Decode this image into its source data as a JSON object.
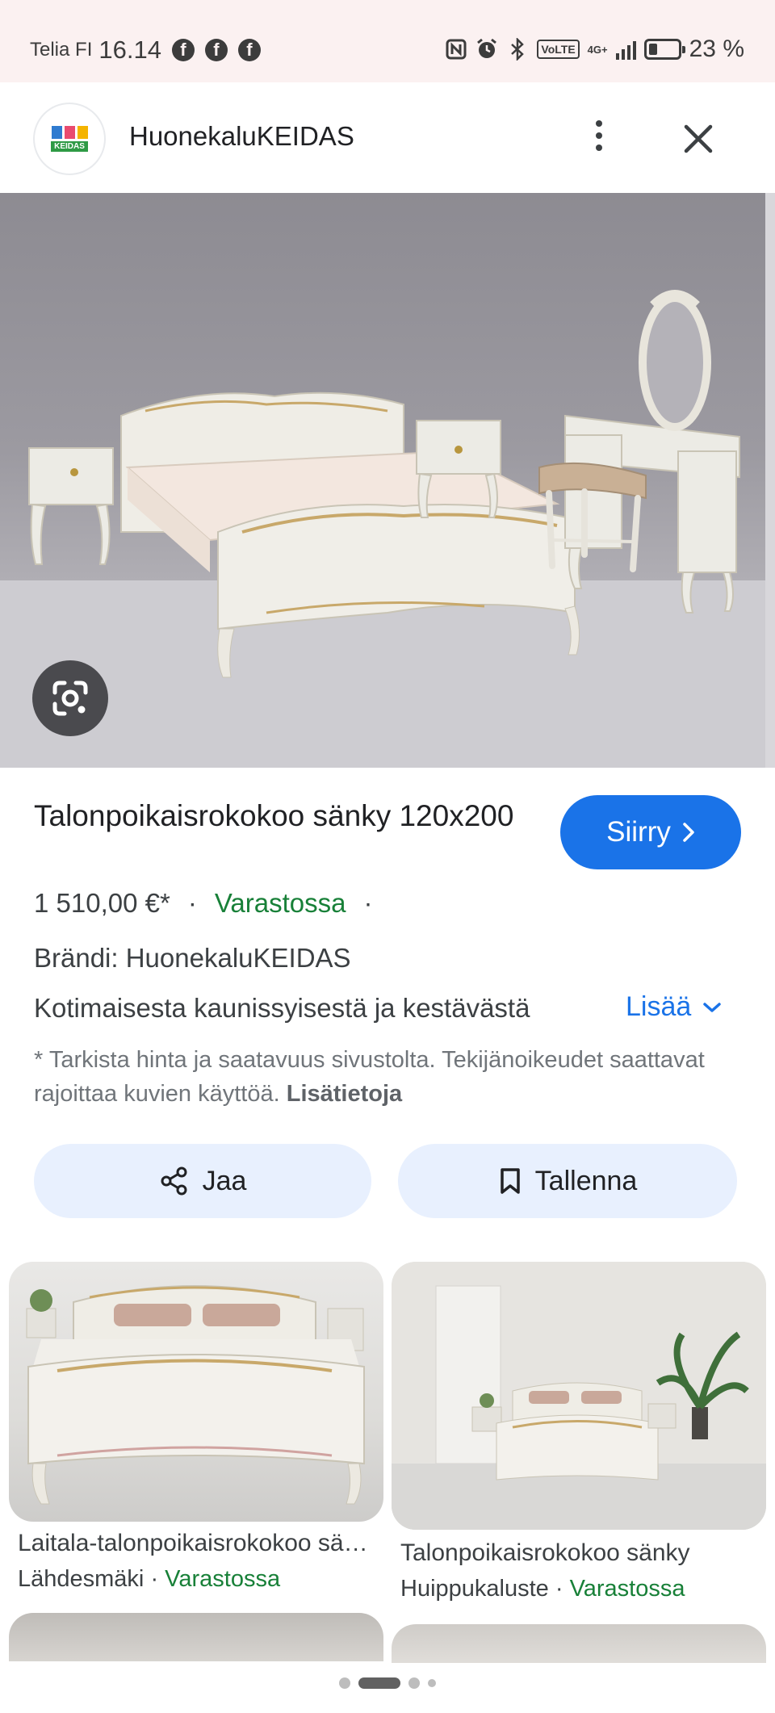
{
  "status_bar": {
    "carrier": "Telia FI",
    "time": "16.14",
    "notification_icons": [
      "facebook-icon",
      "facebook-icon",
      "facebook-icon"
    ],
    "network": "4G+",
    "volte": "VoLTE",
    "battery_percent": "23 %",
    "battery_level": 0.23
  },
  "app_bar": {
    "site_name": "HuonekaluKEIDAS",
    "logo_text": "KEIDAS"
  },
  "product": {
    "title": "Talonpoikaisrokokoo sänky 120x200",
    "goto_label": "Siirry",
    "price": "1 510,00 €*",
    "availability": "Varastossa",
    "brand": "Brändi: HuonekaluKEIDAS",
    "description": "Kotimaisesta kaunissyisestä ja kestävästä",
    "more_label": "Lisää",
    "disclaimer": "* Tarkista hinta ja saatavuus sivustolta. Tekijänoikeudet saattavat rajoittaa kuvien käyttöä.",
    "disclaimer_link": "Lisätietoja"
  },
  "actions": {
    "share_label": "Jaa",
    "save_label": "Tallenna"
  },
  "related": [
    {
      "title": "Laitala-talonpoikaisrokokoo sänky",
      "seller": "Lähdesmäki",
      "availability": "Varastossa"
    },
    {
      "title": "Talonpoikaisrokokoo sänky",
      "seller": "Huippukaluste",
      "availability": "Varastossa"
    }
  ],
  "colors": {
    "accent": "#1a73e8",
    "in_stock": "#188038",
    "action_bg": "#e8f0fe",
    "status_bar_bg": "#fbf1f1"
  }
}
